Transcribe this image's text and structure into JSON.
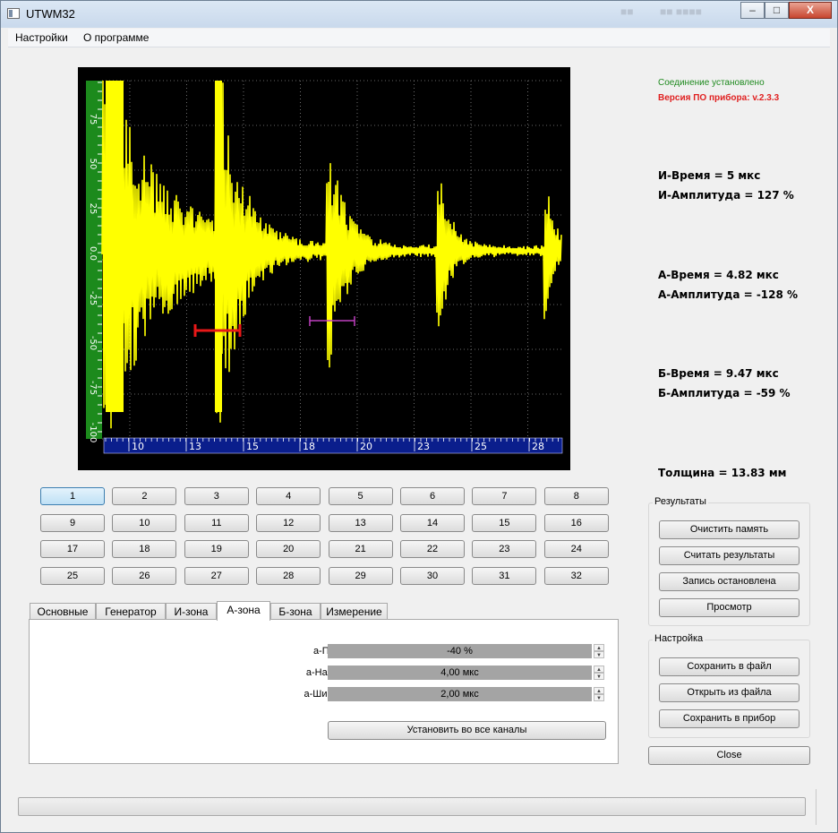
{
  "window": {
    "title": "UTWM32",
    "ghost_text_left": "■■",
    "ghost_text_right": "■■ ■■■■",
    "controls": {
      "minimize": "–",
      "maximize": "□",
      "close": "X"
    }
  },
  "menu": {
    "items": [
      "Настройки",
      "О программе"
    ]
  },
  "status": {
    "connection": "Соединение установлено",
    "connection_color": "#1f8a1f",
    "firmware": "Версия ПО прибора: v.2.3.3",
    "firmware_color": "#e02020"
  },
  "measurements": {
    "i_time": "И-Время = 5 мкс",
    "i_amplitude": "И-Амплитуда = 127 %",
    "a_time": "А-Время = 4.82 мкс",
    "a_amplitude": "А-Амплитуда = -128 %",
    "b_time": "Б-Время = 9.47 мкс",
    "b_amplitude": "Б-Амплитуда = -59 %",
    "thickness": "Толщина = 13.83 мм"
  },
  "scope": {
    "y_ticks": [
      "75",
      "50",
      "25",
      "0.0",
      "-25",
      "-50",
      "-75",
      "-100"
    ],
    "x_ticks": [
      "10",
      "13",
      "15",
      "18",
      "20",
      "23",
      "25",
      "28"
    ],
    "signal_color": "#ffff00",
    "a_gate_color": "#e81818",
    "b_gate_color": "#c040c0",
    "y_axis_color": "#1c8a1c",
    "x_axis_color": "#0a1e8c"
  },
  "channels": [
    "1",
    "2",
    "3",
    "4",
    "5",
    "6",
    "7",
    "8",
    "9",
    "10",
    "11",
    "12",
    "13",
    "14",
    "15",
    "16",
    "17",
    "18",
    "19",
    "20",
    "21",
    "22",
    "23",
    "24",
    "25",
    "26",
    "27",
    "28",
    "29",
    "30",
    "31",
    "32"
  ],
  "tabs": [
    "Основные",
    "Генератор",
    "И-зона",
    "А-зона",
    "Б-зона",
    "Измерение"
  ],
  "active_tab": "А-зона",
  "a_zone": {
    "threshold_label": "а-Порог",
    "threshold_value": "-40 %",
    "start_label": "а-Начало",
    "start_value": "4,00 мкс",
    "width_label": "а-Ширина",
    "width_value": "2,00 мкс",
    "apply_all": "Установить во все каналы"
  },
  "results": {
    "title": "Результаты",
    "clear": "Очистить память",
    "read": "Считать результаты",
    "record": "Запись остановлена",
    "view": "Просмотр"
  },
  "settings": {
    "title": "Настройка",
    "save_file": "Сохранить в файл",
    "open_file": "Открыть из файла",
    "save_device": "Сохранить в прибор"
  },
  "close_button": "Close"
}
